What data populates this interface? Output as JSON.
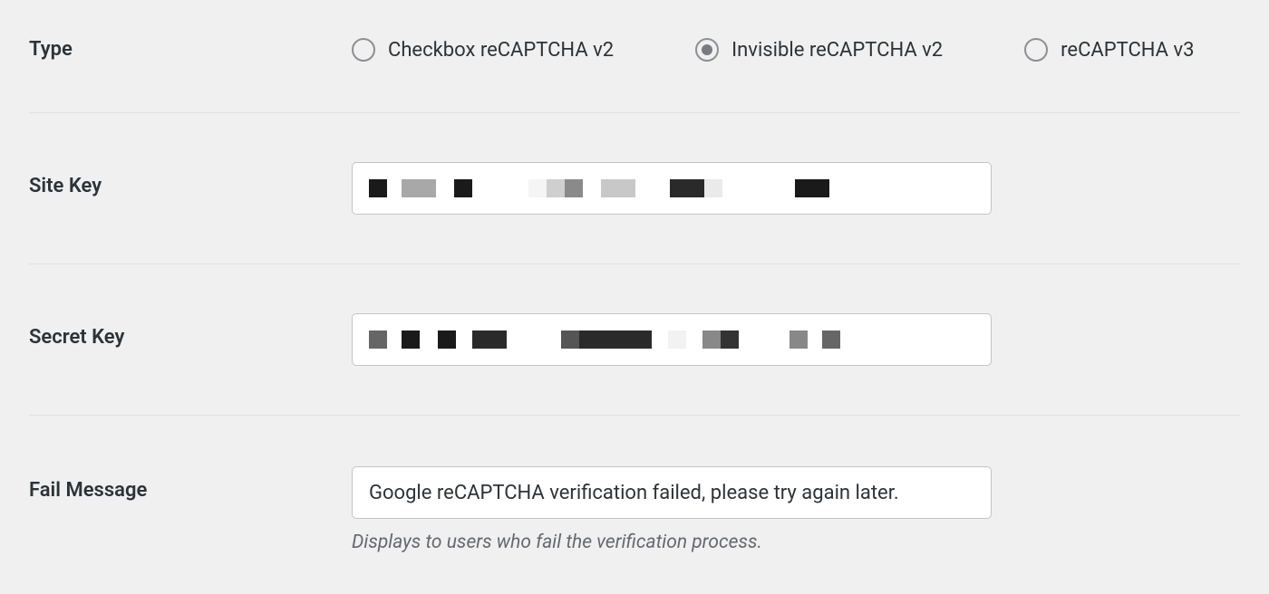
{
  "settings": {
    "type": {
      "label": "Type",
      "options": [
        {
          "label": "Checkbox reCAPTCHA v2",
          "selected": false
        },
        {
          "label": "Invisible reCAPTCHA v2",
          "selected": true
        },
        {
          "label": "reCAPTCHA v3",
          "selected": false
        }
      ]
    },
    "site_key": {
      "label": "Site Key",
      "value": "[redacted]"
    },
    "secret_key": {
      "label": "Secret Key",
      "value": "[redacted]"
    },
    "fail_message": {
      "label": "Fail Message",
      "value": "Google reCAPTCHA verification failed, please try again later.",
      "help": "Displays to users who fail the verification process."
    }
  }
}
